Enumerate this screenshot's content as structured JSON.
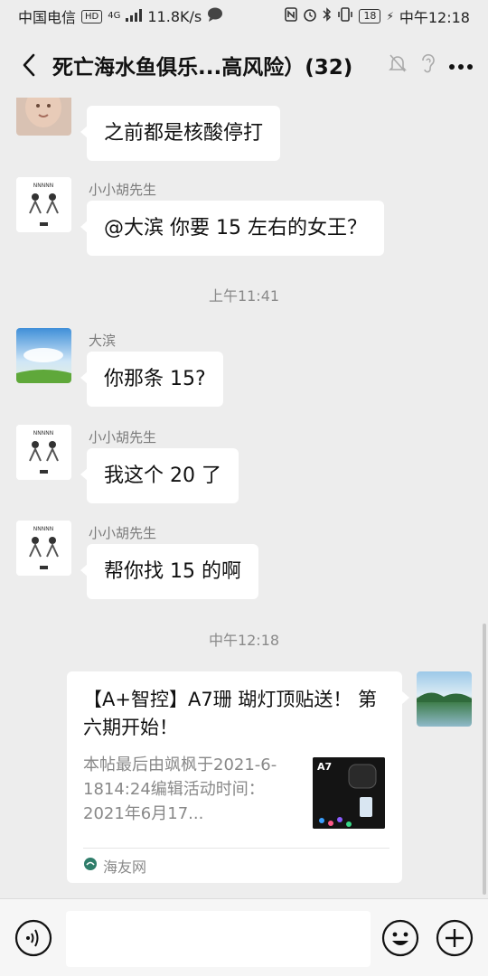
{
  "status_bar": {
    "carrier": "中国电信",
    "hd": "HD",
    "net": "4G",
    "speed": "11.8K/s",
    "battery": "18",
    "time": "中午12:18"
  },
  "nav": {
    "title": "死亡海水鱼俱乐...高风险）(32)"
  },
  "messages": [
    {
      "sender": "",
      "text": "之前都是核酸停打"
    },
    {
      "sender": "小小胡先生",
      "text": "@大滨  你要 15 左右的女王？"
    },
    {
      "sender": "大滨",
      "text": "你那条 15?"
    },
    {
      "sender": "小小胡先生",
      "text": "我这个 20 了"
    },
    {
      "sender": "小小胡先生",
      "text": "帮你找 15 的啊"
    }
  ],
  "timestamps": [
    "上午11:41",
    "中午12:18"
  ],
  "link_card": {
    "title": "【A+智控】A7珊 瑚灯顶贴送！ 第六期开始！",
    "desc": "本帖最后由飒枫于2021-6-1814:24编辑活动时间：2021年6月17...",
    "thumb_label": "A7",
    "source": "海友网"
  },
  "colors": {
    "background": "#ededed",
    "bubble": "#ffffff",
    "meta_text": "#8a8a8a"
  }
}
